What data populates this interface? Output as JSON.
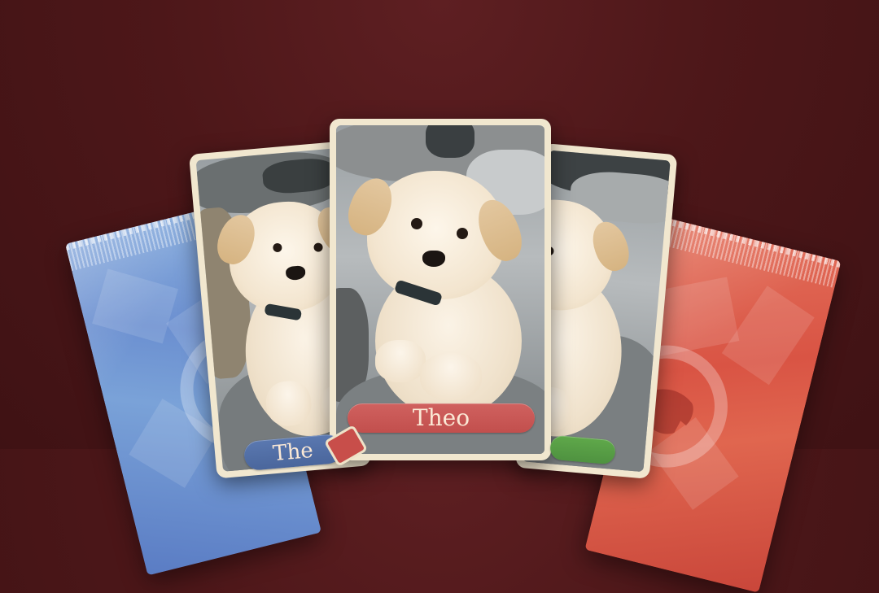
{
  "cards": {
    "center": {
      "name": "Theo",
      "banner_color": "#c95856"
    },
    "left": {
      "name": "The",
      "banner_color": "#5570a8"
    },
    "right": {
      "banner_color": "#58a046"
    }
  },
  "packs": {
    "left": {
      "color": "#7a9fd6"
    },
    "right": {
      "color": "#dc5a48"
    }
  },
  "icons": {
    "pack_emblem": "dog-head-emblem-icon",
    "card_photo": "puppy-photo"
  }
}
